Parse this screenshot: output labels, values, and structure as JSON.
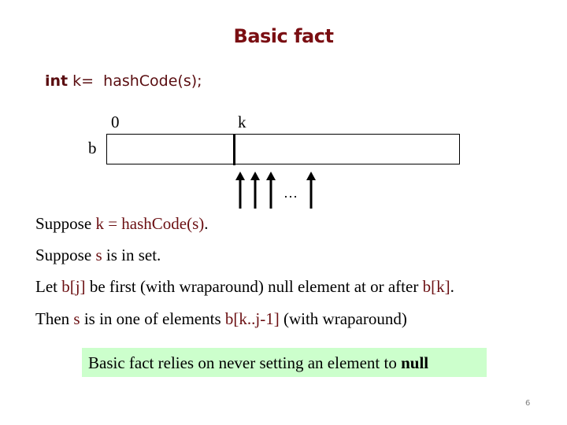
{
  "slide": {
    "title": "Basic fact",
    "code_line": {
      "keyword": "int",
      "rest": " k=  hashCode(s);"
    },
    "diagram": {
      "array_name": "b",
      "index_start_label": "0",
      "index_k_label": "k",
      "ellipsis": "…",
      "arrow_count": 4
    },
    "lines": [
      [
        {
          "t": "Suppose ",
          "c": "black"
        },
        {
          "t": "k = hashCode(s)",
          "c": "red"
        },
        {
          "t": ".",
          "c": "black"
        }
      ],
      [
        {
          "t": "Suppose ",
          "c": "black"
        },
        {
          "t": "s",
          "c": "red"
        },
        {
          "t": " is in set.",
          "c": "black"
        }
      ],
      [
        {
          "t": "Let ",
          "c": "black"
        },
        {
          "t": "b[j]",
          "c": "red"
        },
        {
          "t": " be first (with wraparound) null element at or after ",
          "c": "black"
        },
        {
          "t": "b[k]",
          "c": "red"
        },
        {
          "t": ".",
          "c": "black"
        }
      ],
      [
        {
          "t": "Then ",
          "c": "black"
        },
        {
          "t": "s",
          "c": "red"
        },
        {
          "t": " is in one of elements ",
          "c": "black"
        },
        {
          "t": "b[k..j-1]",
          "c": "red"
        },
        {
          "t": " (with wraparound)",
          "c": "black"
        }
      ]
    ],
    "note": {
      "text": "Basic fact relies on never setting an element to ",
      "bold": "null",
      "background": "#ccffcc"
    },
    "page_number": "6"
  }
}
